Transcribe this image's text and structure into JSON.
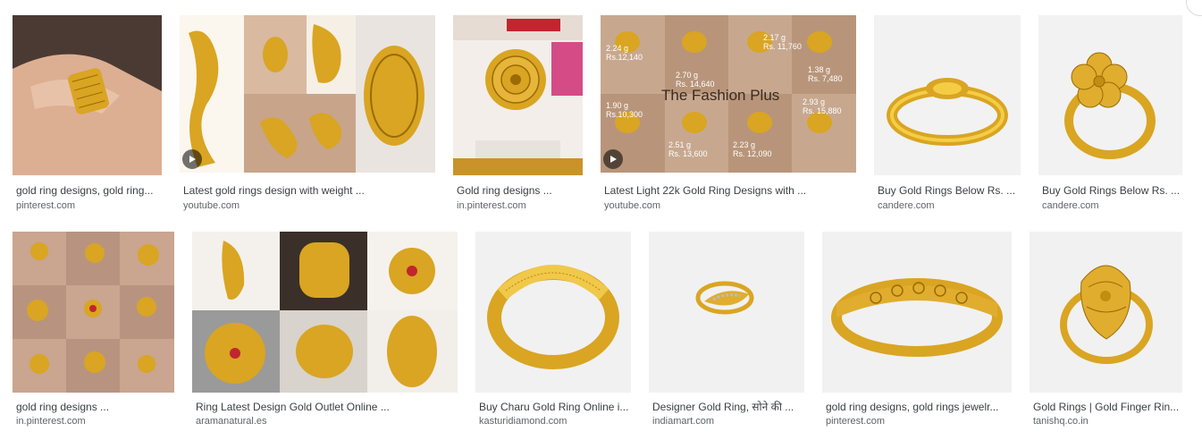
{
  "results": [
    {
      "title": "gold ring designs, gold ring...",
      "source": "pinterest.com",
      "video": false
    },
    {
      "title": "Latest gold rings design with weight ...",
      "source": "youtube.com",
      "video": true
    },
    {
      "title": "Gold ring designs ...",
      "source": "in.pinterest.com",
      "video": false
    },
    {
      "title": "Latest Light 22k Gold Ring Designs with ...",
      "source": "youtube.com",
      "video": true,
      "overlay_text": "The Fashion Plus",
      "weights": [
        [
          "2.24 g",
          "Rs.12,140"
        ],
        [
          "2.70 g",
          "Rs. 14,640"
        ],
        [
          "2.17 g",
          "Rs. 11,760"
        ],
        [
          "1.38 g",
          "Rs. 7,480"
        ],
        [
          "1.90 g",
          "Rs.10,300"
        ],
        [
          "2.51 g",
          "Rs. 13,600"
        ],
        [
          "2.23 g",
          "Rs. 12,090"
        ],
        [
          "2.93 g",
          "Rs. 15,880"
        ]
      ]
    },
    {
      "title": "Buy Gold Rings Below Rs. ...",
      "source": "candere.com",
      "video": false
    },
    {
      "title": "Buy Gold Rings Below Rs. ...",
      "source": "candere.com",
      "video": false
    },
    {
      "title": "gold ring designs ...",
      "source": "in.pinterest.com",
      "video": false
    },
    {
      "title": "Ring Latest Design Gold Outlet Online ...",
      "source": "aramanatural.es",
      "video": false
    },
    {
      "title": "Buy Charu Gold Ring Online i...",
      "source": "kasturidiamond.com",
      "video": false
    },
    {
      "title": "Designer Gold Ring, सोने की ...",
      "source": "indiamart.com",
      "video": false
    },
    {
      "title": "gold ring designs, gold rings jewelr...",
      "source": "pinterest.com",
      "video": false
    },
    {
      "title": "Gold Rings | Gold Finger Rin...",
      "source": "tanishq.co.in",
      "video": false
    }
  ],
  "icons": {
    "play": "play-icon"
  },
  "colors": {
    "gold": "#d4a017",
    "gold_light": "#f5cd45",
    "gold_dark": "#9a6b05",
    "skin": "#e2b79c",
    "bg_light": "#f1f1f1"
  }
}
